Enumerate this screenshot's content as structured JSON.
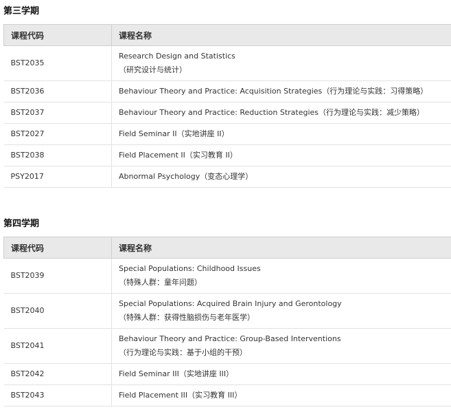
{
  "sections": [
    {
      "title": "第三学期",
      "header": {
        "code": "课程代码",
        "name": "课程名称"
      },
      "rows": [
        {
          "code": "BST2035",
          "name_lines": [
            "Research Design and Statistics",
            "（研究设计与统计）"
          ]
        },
        {
          "code": "BST2036",
          "name_lines": [
            "Behaviour Theory and Practice: Acquisition Strategies（行为理论与实践：习得策略）"
          ]
        },
        {
          "code": "BST2037",
          "name_lines": [
            "Behaviour Theory and Practice: Reduction Strategies（行为理论与实践：减少策略）"
          ]
        },
        {
          "code": "BST2027",
          "name_lines": [
            "Field Seminar II（实地讲座 II）"
          ]
        },
        {
          "code": "BST2038",
          "name_lines": [
            "Field Placement II（实习教育 II）"
          ]
        },
        {
          "code": "PSY2017",
          "name_lines": [
            "Abnormal Psychology（变态心理学）"
          ]
        }
      ]
    },
    {
      "title": "第四学期",
      "header": {
        "code": "课程代码",
        "name": "课程名称"
      },
      "rows": [
        {
          "code": "BST2039",
          "name_lines": [
            "Special Populations: Childhood Issues",
            "（特殊人群：童年问题）"
          ]
        },
        {
          "code": "BST2040",
          "name_lines": [
            "Special Populations: Acquired Brain Injury and Gerontology",
            "（特殊人群：获得性脑损伤与老年医学）"
          ]
        },
        {
          "code": "BST2041",
          "name_lines": [
            "Behaviour Theory and Practice: Group-Based Interventions",
            "（行为理论与实践：基于小组的干预）"
          ]
        },
        {
          "code": "BST2042",
          "name_lines": [
            "Field Seminar III（实地讲座 III）"
          ]
        },
        {
          "code": "BST2043",
          "name_lines": [
            "Field Placement III（实习教育 III）"
          ]
        }
      ]
    }
  ]
}
